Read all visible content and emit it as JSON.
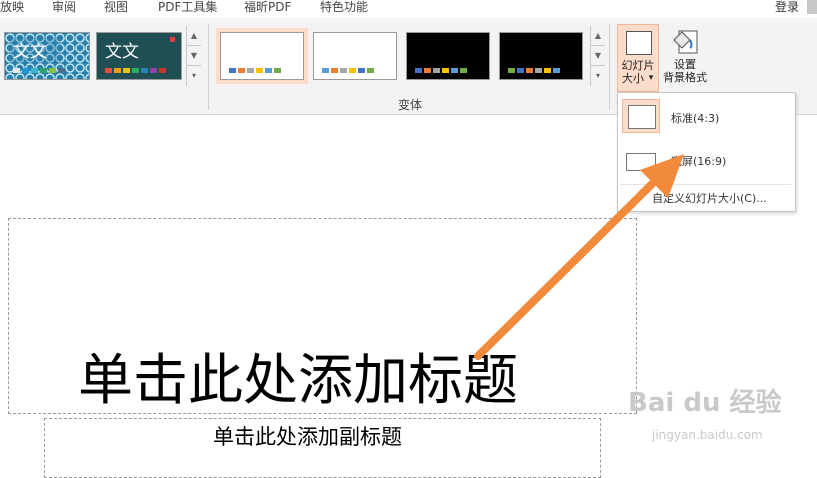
{
  "tabs": [
    "放映",
    "审阅",
    "视图",
    "PDF工具集",
    "福昕PDF",
    "特色功能"
  ],
  "account": {
    "login": "登录"
  },
  "ribbon": {
    "theme_thumbs": [
      {
        "label": "文文"
      },
      {
        "label": "文文"
      }
    ],
    "variant_group_label": "变体",
    "slide_size_button": {
      "line1": "幻灯片",
      "line2": "大小",
      "caret": "▾"
    },
    "format_bg_button": {
      "line1": "设置",
      "line2": "背景格式"
    },
    "gallery_scroll": {
      "up": "▲",
      "down": "▼",
      "more": "▾"
    }
  },
  "dropdown": {
    "items": [
      {
        "label": "标准(4:3)"
      },
      {
        "label": "宽屏(16:9)"
      },
      {
        "label": "自定义幻灯片大小(C)..."
      }
    ]
  },
  "slide": {
    "title_placeholder": "单击此处添加标题",
    "subtitle_placeholder": "单击此处添加副标题"
  },
  "watermark": {
    "brand": "Bai du 经验",
    "url": "jingyan.baidu.com"
  },
  "colors": {
    "accent_selected_fill": "#fbdccb",
    "accent_selected_border": "#f3b48f",
    "arrow": "#f28a3b",
    "ribbon_bg": "#f3f3f3"
  }
}
